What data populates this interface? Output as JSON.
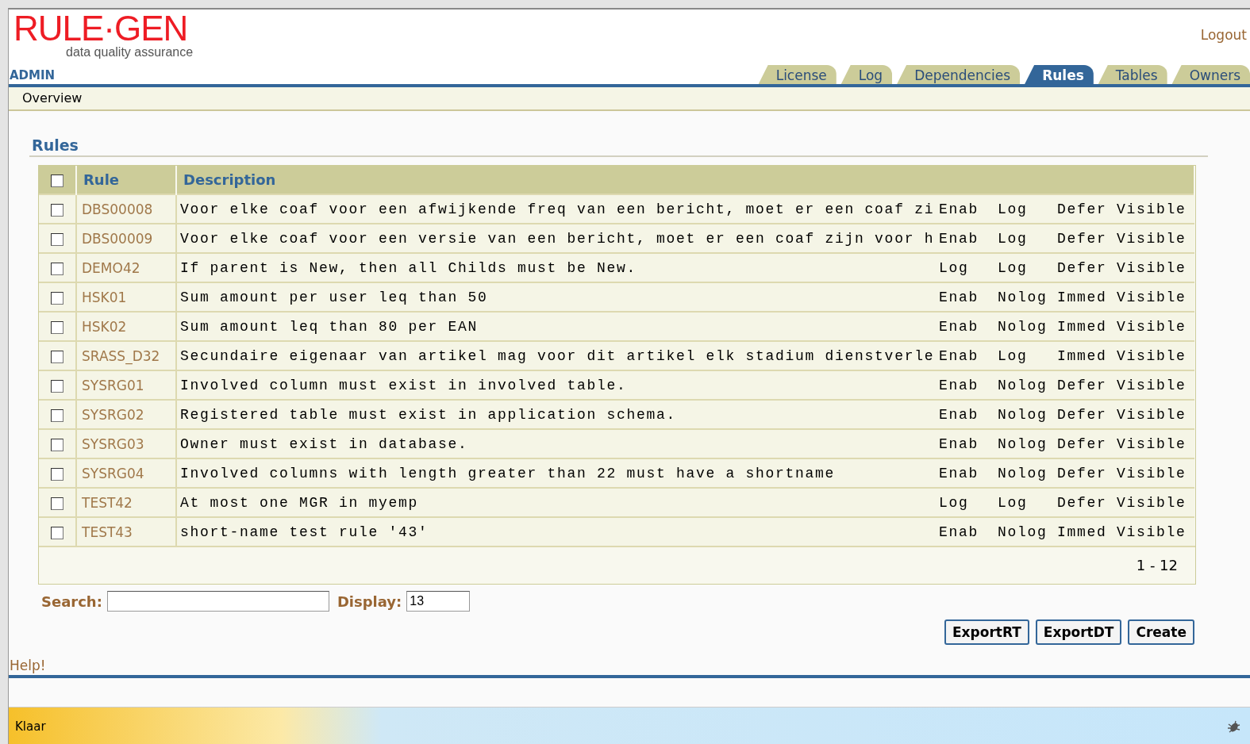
{
  "logo": {
    "title": "RULE·GEN",
    "subtitle": "data quality assurance"
  },
  "user": "ADMIN",
  "logout": "Logout",
  "tabs": [
    {
      "label": "License",
      "selected": false
    },
    {
      "label": "Log",
      "selected": false
    },
    {
      "label": "Dependencies",
      "selected": false
    },
    {
      "label": "Rules",
      "selected": true
    },
    {
      "label": "Tables",
      "selected": false
    },
    {
      "label": "Owners",
      "selected": false
    }
  ],
  "subnav": "Overview",
  "heading": "Rules",
  "table": {
    "select_all_checked": false,
    "columns": [
      "Rule",
      "Description"
    ],
    "rows": [
      {
        "checked": false,
        "rule": "DBS00008",
        "description": "Voor elke coaf voor een afwijkende freq van een bericht, moet er een coaf zi",
        "column_3": "Enab",
        "column_4": "Log",
        "column_5": "Defer",
        "column_6": "Visible"
      },
      {
        "checked": false,
        "rule": "DBS00009",
        "description": "Voor elke coaf voor een versie van een bericht, moet er een coaf zijn voor h",
        "column_3": "Enab",
        "column_4": "Log",
        "column_5": "Defer",
        "column_6": "Visible"
      },
      {
        "checked": false,
        "rule": "DEMO42",
        "description": "If parent is New, then all Childs must be New.",
        "column_3": "Log",
        "column_4": "Log",
        "column_5": "Defer",
        "column_6": "Visible"
      },
      {
        "checked": false,
        "rule": "HSK01",
        "description": "Sum amount per user leq than 50",
        "column_3": "Enab",
        "column_4": "Nolog",
        "column_5": "Immed",
        "column_6": "Visible"
      },
      {
        "checked": false,
        "rule": "HSK02",
        "description": "Sum amount leq than 80 per EAN",
        "column_3": "Enab",
        "column_4": "Nolog",
        "column_5": "Immed",
        "column_6": "Visible"
      },
      {
        "checked": false,
        "rule": "SRASS_D32",
        "description": "Secundaire eigenaar van artikel mag voor dit artikel elk stadium dienstverle",
        "column_3": "Enab",
        "column_4": "Log",
        "column_5": "Immed",
        "column_6": "Visible"
      },
      {
        "checked": false,
        "rule": "SYSRG01",
        "description": "Involved column must exist in involved table.",
        "column_3": "Enab",
        "column_4": "Nolog",
        "column_5": "Defer",
        "column_6": "Visible"
      },
      {
        "checked": false,
        "rule": "SYSRG02",
        "description": "Registered table must exist in application schema.",
        "column_3": "Enab",
        "column_4": "Nolog",
        "column_5": "Defer",
        "column_6": "Visible"
      },
      {
        "checked": false,
        "rule": "SYSRG03",
        "description": "Owner must exist in database.",
        "column_3": "Enab",
        "column_4": "Nolog",
        "column_5": "Defer",
        "column_6": "Visible"
      },
      {
        "checked": false,
        "rule": "SYSRG04",
        "description": "Involved columns with length greater than 22 must have a shortname",
        "column_3": "Enab",
        "column_4": "Nolog",
        "column_5": "Defer",
        "column_6": "Visible"
      },
      {
        "checked": false,
        "rule": "TEST42",
        "description": "At most one MGR in myemp",
        "column_3": "Log",
        "column_4": "Log",
        "column_5": "Defer",
        "column_6": "Visible"
      },
      {
        "checked": false,
        "rule": "TEST43",
        "description": "short-name test rule '43'",
        "column_3": "Enab",
        "column_4": "Nolog",
        "column_5": "Immed",
        "column_6": "Visible"
      }
    ],
    "range": "1 - 12"
  },
  "search": {
    "label": "Search:"
  },
  "display": {
    "label": "Display:",
    "value": "13"
  },
  "buttons": [
    "ExportRT",
    "ExportDT",
    "Create"
  ],
  "help": "Help!",
  "status_bar": {
    "text": "Klaar"
  }
}
